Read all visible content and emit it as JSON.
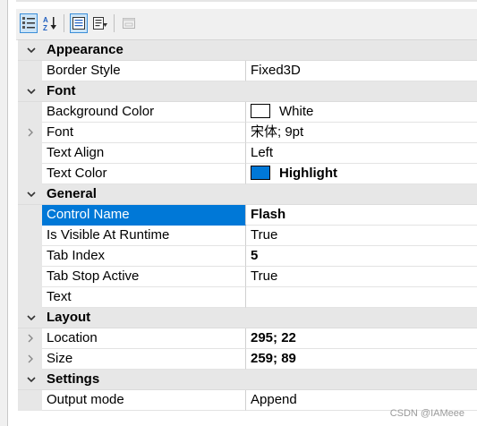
{
  "toolbar": {
    "buttons": [
      {
        "icon": "categorized-icon",
        "active": true
      },
      {
        "icon": "alphabetical-icon",
        "active": false
      },
      {
        "icon": "properties-icon",
        "active": true
      },
      {
        "icon": "events-icon",
        "active": false
      },
      {
        "icon": "property-pages-icon",
        "active": false
      }
    ]
  },
  "grid": {
    "categories": {
      "appearance": {
        "label": "Appearance"
      },
      "font": {
        "label": "Font"
      },
      "general": {
        "label": "General"
      },
      "layout": {
        "label": "Layout"
      },
      "settings": {
        "label": "Settings"
      }
    },
    "rows": {
      "border_style": {
        "name": "Border Style",
        "value": "Fixed3D"
      },
      "background_color": {
        "name": "Background Color",
        "value": "White",
        "swatch": "#ffffff"
      },
      "font": {
        "name": "Font",
        "value": "宋体; 9pt",
        "expandable": true
      },
      "text_align": {
        "name": "Text Align",
        "value": "Left"
      },
      "text_color": {
        "name": "Text Color",
        "value": "Highlight",
        "swatch": "#0078d7"
      },
      "control_name": {
        "name": "Control Name",
        "value": "Flash",
        "selected": true
      },
      "is_visible": {
        "name": "Is Visible At Runtime",
        "value": "True"
      },
      "tab_index": {
        "name": "Tab Index",
        "value": "5"
      },
      "tab_stop": {
        "name": "Tab Stop Active",
        "value": "True"
      },
      "text": {
        "name": "Text",
        "value": ""
      },
      "location": {
        "name": "Location",
        "value": "295; 22",
        "expandable": true
      },
      "size": {
        "name": "Size",
        "value": "259; 89",
        "expandable": true
      },
      "output_mode": {
        "name": "Output mode",
        "value": "Append"
      }
    }
  },
  "colors": {
    "selection": "#0078d7",
    "category_bg": "#e7e7e7",
    "toolbar_bg": "#f0f0f0"
  },
  "watermark": "CSDN @IAMeee"
}
